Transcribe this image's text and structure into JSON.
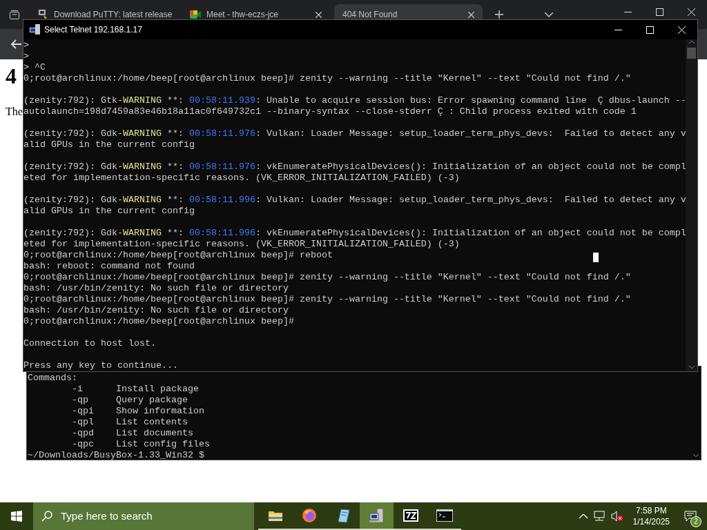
{
  "browser": {
    "tabs": [
      {
        "title": "Download PuTTY: latest release",
        "selected": false
      },
      {
        "title": "Meet - thw-eczs-jce",
        "selected": false
      },
      {
        "title": "404 Not Found",
        "selected": true
      }
    ],
    "page": {
      "heading": "4",
      "text": "The"
    }
  },
  "telnet": {
    "title": "Select Telnet 192.168.1.17",
    "lines": [
      {
        "kind": "text",
        "segments": [
          {
            "kind": "plain",
            "text": ">"
          }
        ]
      },
      {
        "kind": "text",
        "segments": [
          {
            "kind": "plain",
            "text": ">"
          }
        ]
      },
      {
        "kind": "text",
        "segments": [
          {
            "kind": "plain",
            "text": "> ^C"
          }
        ]
      },
      {
        "kind": "text",
        "segments": [
          {
            "kind": "plain",
            "text": "0;root@archlinux:/home/beep[root@archlinux beep]# zenity --warning --title \"Kernel\" --text \"Could not find /.\""
          }
        ]
      },
      {
        "kind": "blank"
      },
      {
        "kind": "text",
        "segments": [
          {
            "kind": "plain",
            "text": "(zenity:792): Gtk-"
          },
          {
            "kind": "warn",
            "text": "WARNING"
          },
          {
            "kind": "plain",
            "text": " **: "
          },
          {
            "kind": "time",
            "text": "00:58:11.939"
          },
          {
            "kind": "plain",
            "text": ": Unable to acquire session bus: Error spawning command line  Ç dbus-launch --"
          }
        ]
      },
      {
        "kind": "text",
        "segments": [
          {
            "kind": "plain",
            "text": "autolaunch=198d7459a83e46b18a11ac0f649732c1 --binary-syntax --close-stderr Ç : Child process exited with code 1"
          }
        ]
      },
      {
        "kind": "blank"
      },
      {
        "kind": "text",
        "segments": [
          {
            "kind": "plain",
            "text": "(zenity:792): Gdk-"
          },
          {
            "kind": "warn",
            "text": "WARNING"
          },
          {
            "kind": "plain",
            "text": " **: "
          },
          {
            "kind": "time",
            "text": "00:58:11.976"
          },
          {
            "kind": "plain",
            "text": ": Vulkan: Loader Message: setup_loader_term_phys_devs:  Failed to detect any v"
          }
        ]
      },
      {
        "kind": "text",
        "segments": [
          {
            "kind": "plain",
            "text": "alid GPUs in the current config"
          }
        ]
      },
      {
        "kind": "blank"
      },
      {
        "kind": "text",
        "segments": [
          {
            "kind": "plain",
            "text": "(zenity:792): Gdk-"
          },
          {
            "kind": "warn",
            "text": "WARNING"
          },
          {
            "kind": "plain",
            "text": " **: "
          },
          {
            "kind": "time",
            "text": "00:58:11.976"
          },
          {
            "kind": "plain",
            "text": ": vkEnumeratePhysicalDevices(): Initialization of an object could not be compl"
          }
        ]
      },
      {
        "kind": "text",
        "segments": [
          {
            "kind": "plain",
            "text": "eted for implementation-specific reasons. (VK_ERROR_INITIALIZATION_FAILED) (-3)"
          }
        ]
      },
      {
        "kind": "blank"
      },
      {
        "kind": "text",
        "segments": [
          {
            "kind": "plain",
            "text": "(zenity:792): Gdk-"
          },
          {
            "kind": "warn",
            "text": "WARNING"
          },
          {
            "kind": "plain",
            "text": " **: "
          },
          {
            "kind": "time",
            "text": "00:58:11.996"
          },
          {
            "kind": "plain",
            "text": ": Vulkan: Loader Message: setup_loader_term_phys_devs:  Failed to detect any v"
          }
        ]
      },
      {
        "kind": "text",
        "segments": [
          {
            "kind": "plain",
            "text": "alid GPUs in the current config"
          }
        ]
      },
      {
        "kind": "blank"
      },
      {
        "kind": "text",
        "segments": [
          {
            "kind": "plain",
            "text": "(zenity:792): Gdk-"
          },
          {
            "kind": "warn",
            "text": "WARNING"
          },
          {
            "kind": "plain",
            "text": " **: "
          },
          {
            "kind": "time",
            "text": "00:58:11.996"
          },
          {
            "kind": "plain",
            "text": ": vkEnumeratePhysicalDevices(): Initialization of an object could not be compl"
          }
        ]
      },
      {
        "kind": "text",
        "segments": [
          {
            "kind": "plain",
            "text": "eted for implementation-specific reasons. (VK_ERROR_INITIALIZATION_FAILED) (-3)"
          }
        ]
      },
      {
        "kind": "text",
        "segments": [
          {
            "kind": "plain",
            "text": "0;root@archlinux:/home/beep[root@archlinux beep]# reboot"
          }
        ]
      },
      {
        "kind": "text",
        "segments": [
          {
            "kind": "plain",
            "text": "bash: reboot: command not found"
          }
        ]
      },
      {
        "kind": "text",
        "segments": [
          {
            "kind": "plain",
            "text": "0;root@archlinux:/home/beep[root@archlinux beep]# zenity --warning --title \"Kernel\" --text \"Could not find /.\""
          }
        ]
      },
      {
        "kind": "text",
        "segments": [
          {
            "kind": "plain",
            "text": "bash: /usr/bin/zenity: No such file or directory"
          }
        ]
      },
      {
        "kind": "text",
        "segments": [
          {
            "kind": "plain",
            "text": "0;root@archlinux:/home/beep[root@archlinux beep]# zenity --warning --title \"Kernel\" --text \"Could not find /.\""
          }
        ]
      },
      {
        "kind": "text",
        "segments": [
          {
            "kind": "plain",
            "text": "bash: /usr/bin/zenity: No such file or directory"
          }
        ]
      },
      {
        "kind": "text",
        "segments": [
          {
            "kind": "plain",
            "text": "0;root@archlinux:/home/beep[root@archlinux beep]#"
          }
        ]
      },
      {
        "kind": "blank"
      },
      {
        "kind": "text",
        "segments": [
          {
            "kind": "plain",
            "text": "Connection to host lost."
          }
        ]
      },
      {
        "kind": "blank"
      },
      {
        "kind": "text",
        "segments": [
          {
            "kind": "plain",
            "text": "Press any key to continue..."
          }
        ]
      }
    ]
  },
  "console": {
    "heading": "Commands:",
    "options": [
      {
        "flag": "-i",
        "description": "Install package"
      },
      {
        "flag": "-qp",
        "description": "Query package"
      },
      {
        "flag": "-qpi",
        "description": "Show information"
      },
      {
        "flag": "-qpl",
        "description": "List contents"
      },
      {
        "flag": "-qpd",
        "description": "List documents"
      },
      {
        "flag": "-qpc",
        "description": "List config files"
      }
    ],
    "prompt": "~/Downloads/BusyBox-1.33_Win32 $"
  },
  "taskbar": {
    "search_placeholder": "Type here to search",
    "apps": [
      {
        "selected": false
      },
      {
        "selected": false
      },
      {
        "selected": false
      },
      {
        "selected": true
      },
      {
        "selected": false
      },
      {
        "selected": false
      }
    ],
    "time": "7:58 PM",
    "date": "1/14/2025",
    "notifications": "2"
  }
}
